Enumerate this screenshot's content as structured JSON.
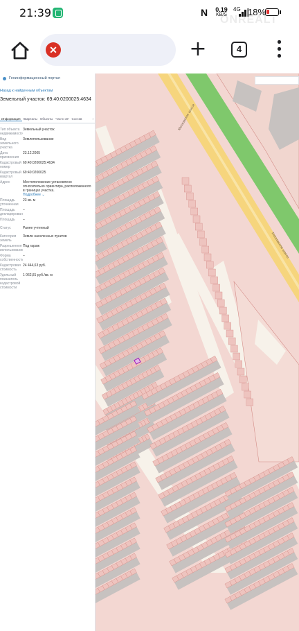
{
  "status_bar": {
    "time": "21:39",
    "nfc": "N",
    "speed_value": "0.19",
    "speed_unit": "KB/S",
    "network": "4G",
    "battery": "18%",
    "icons": [
      "app-notification-icon",
      "nfc-icon",
      "signal-icon",
      "battery-icon"
    ]
  },
  "watermark": "ONREALT",
  "browser": {
    "home_icon": "home-icon",
    "site_icon_glyph": "✕",
    "new_tab_glyph": "+",
    "tab_count": "4",
    "menu_icon": "more-vert-icon"
  },
  "panel": {
    "portal_title": "Геоинформационный портал",
    "back_link": "Назад к найденным объектам",
    "parcel_title": "Земельный участок: 69:40:0200025:4634",
    "collapse_glyph": "«",
    "tabs": [
      {
        "label": "Информация",
        "active": true
      },
      {
        "label": "Кварталы",
        "active": false
      },
      {
        "label": "Объекты",
        "active": false
      },
      {
        "label": "Части ЗУ",
        "active": false
      },
      {
        "label": "Состав",
        "active": false
      }
    ],
    "tabs_more": "›",
    "rows": [
      {
        "key": "Тип объекта недвижимости",
        "value": "Земельный участок"
      },
      {
        "key": "Вид земельного участка",
        "value": "Землепользование"
      },
      {
        "key": "Дата присвоения",
        "value": "23.12.2005"
      },
      {
        "key": "Кадастровый номер",
        "value": "69:40:0200025:4634"
      },
      {
        "key": "Кадастровый квартал",
        "value": "69:40:0200025"
      },
      {
        "key": "Адрес",
        "value": "Местоположение установлено относительно ориентира, расположенного в границах участка.",
        "more": "Подробнее ⌄"
      },
      {
        "key": "Площадь уточненная",
        "value": "23 кв. м"
      },
      {
        "key": "Площадь декларированная",
        "value": "–"
      },
      {
        "key": "Площадь",
        "value": "–"
      },
      {
        "key": "Статус",
        "value": "Ранее учтенный"
      },
      {
        "key": "Категория земель",
        "value": "Земли населенных пунктов"
      },
      {
        "key": "Разрешенное использование",
        "value": "Под гараж"
      },
      {
        "key": "Форма собственности",
        "value": "–"
      },
      {
        "key": "Кадастровая стоимость",
        "value": "24 444,63 руб."
      },
      {
        "key": "Удельный показатель кадастровой стоимости",
        "value": "1 062,81 руб./кв. м"
      }
    ]
  },
  "map": {
    "road_label_1": "Московское шоссе",
    "road_label_2": "Московское шоссе",
    "colors": {
      "parcel_fill": "#f3d7d2",
      "parcel_stroke": "#d48d88",
      "garage_fill": "#eec4bf",
      "building_fill": "#c7c2c0",
      "road_fill": "#f7f2ea",
      "highway_fill": "#f6d57d",
      "green_fill": "#7fc86c",
      "selected_stroke": "#a01fbf"
    }
  }
}
